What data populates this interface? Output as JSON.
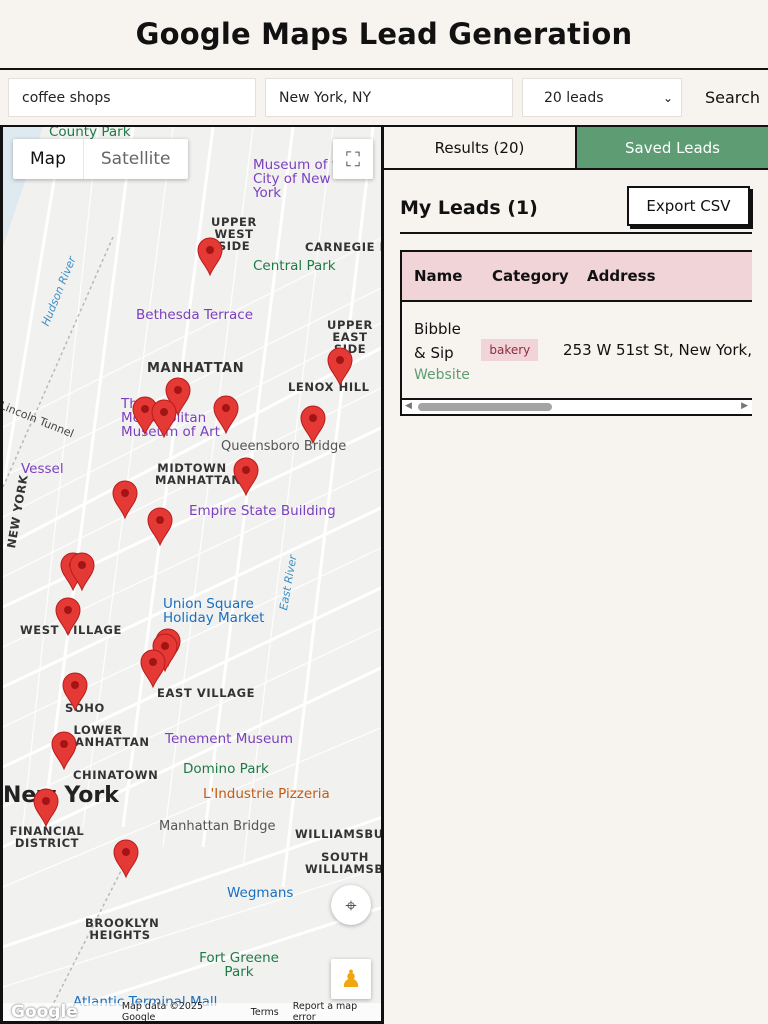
{
  "header": {
    "title": "Google Maps Lead Generation"
  },
  "search": {
    "query": "coffee shops",
    "location": "New York, NY",
    "count_selected": "20 leads",
    "button": "Search"
  },
  "map": {
    "type_map": "Map",
    "type_satellite": "Satellite",
    "footer": {
      "logo": "Google",
      "data": "Map data ©2025 Google",
      "terms": "Terms",
      "report": "Report a map error"
    },
    "labels": {
      "county_park": "County Park",
      "museum_city": "Museum of the City of New York",
      "upper_west_side": "UPPER WEST SIDE",
      "carnegie_hill": "CARNEGIE HILL",
      "central_park": "Central Park",
      "bethesda": "Bethesda Terrace",
      "upper_east_side": "UPPER EAST SIDE",
      "manhattan": "MANHATTAN",
      "lenox_hill": "LENOX HILL",
      "met": "The Metropolitan Museum of Art",
      "queensboro": "Queensboro Bridge",
      "vessel": "Vessel",
      "midtown": "MIDTOWN MANHATTAN",
      "empire": "Empire State Building",
      "union_square": "Union Square Holiday Market",
      "west_village": "WEST VILLAGE",
      "east_village": "EAST VILLAGE",
      "soho": "SOHO",
      "lower_manhattan": "LOWER MANHATTAN",
      "tenement": "Tenement Museum",
      "chinatown": "CHINATOWN",
      "domino": "Domino Park",
      "new_york": "New York",
      "lindustrie": "L'Industrie Pizzeria",
      "financial": "FINANCIAL DISTRICT",
      "manhattan_bridge": "Manhattan Bridge",
      "williamsburg": "WILLIAMSBURG",
      "south_williamsburg": "SOUTH WILLIAMSBURG",
      "wegmans": "Wegmans",
      "brooklyn_heights": "BROOKLYN HEIGHTS",
      "fort_greene": "Fort Greene Park",
      "atlantic": "Atlantic Terminal Mall",
      "hudson_river": "Hudson River",
      "east_river": "East River",
      "lincoln_tunnel": "Lincoln Tunnel",
      "new_york_side": "NEW YORK"
    }
  },
  "tabs": {
    "results": "Results (20)",
    "saved": "Saved Leads"
  },
  "saved": {
    "title": "My Leads (1)",
    "export": "Export CSV",
    "columns": [
      "Name",
      "Category",
      "Address"
    ],
    "rows": [
      {
        "name_line1": "Bibble",
        "name_line2": "& Sip",
        "website": "Website",
        "category": "bakery",
        "address": "253 W 51st St, New York,"
      }
    ]
  },
  "colors": {
    "accent_green": "#5e9c73",
    "pink_header": "#f1d4d8",
    "pin_red": "#e53935"
  }
}
